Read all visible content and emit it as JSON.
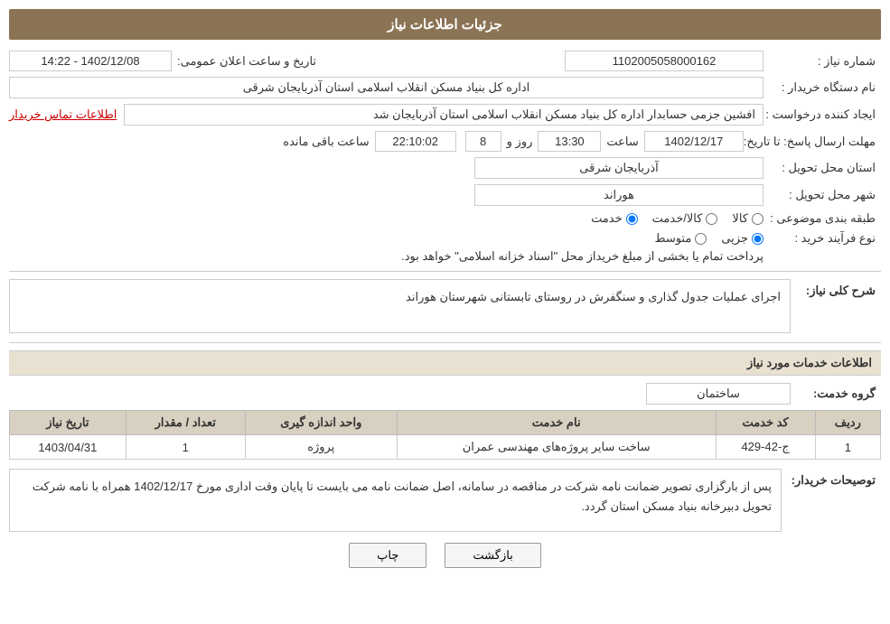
{
  "header": {
    "title": "جزئیات اطلاعات نیاز"
  },
  "fields": {
    "shomara_label": "شماره نیاز :",
    "shomara_value": "1102005058000162",
    "namdastgah_label": "نام دستگاه خریدار :",
    "namdastgah_value": "اداره کل بنیاد مسکن انقلاب اسلامی استان آذربایجان شرقی",
    "ijad_label": "ایجاد کننده درخواست :",
    "ijad_value": "افشین جزمی حسابدار اداره کل بنیاد مسکن انقلاب اسلامی استان آذربایجان شد",
    "ettelaat_tamas": "اطلاعات تماس خریدار",
    "mohlet_label": "مهلت ارسال پاسخ: تا تاریخ:",
    "date_value": "1402/12/17",
    "saaat_label": "ساعت",
    "saaat_value": "13:30",
    "rooz_label": "روز و",
    "rooz_value": "8",
    "baqi_value": "22:10:02",
    "baqi_label": "ساعت باقی مانده",
    "ostan_label": "استان محل تحویل :",
    "ostan_value": "آذربایجان شرقی",
    "shahr_label": "شهر محل تحویل :",
    "shahr_value": "هوراند",
    "tabaqe_label": "طبقه بندی موضوعی :",
    "radio_khidmat": "خدمت",
    "radio_kala_khidmat": "کالا/خدمت",
    "radio_kala": "کالا",
    "noeFarayand_label": "نوع فرآیند خرید :",
    "radio_jozee": "جزیی",
    "radio_motavaset": "متوسط",
    "radio_full_text": "پرداخت تمام یا بخشی از مبلغ خریداز محل \"اسناد خزانه اسلامی\" خواهد بود.",
    "sharh_label": "شرح کلی نیاز:",
    "sharh_value": "اجرای عملیات جدول گذاری و سنگفرش در روستای تابستانی شهرستان هوراند",
    "khidmat_title": "اطلاعات خدمات مورد نیاز",
    "grooh_label": "گروه خدمت:",
    "grooh_value": "ساختمان",
    "table": {
      "headers": [
        "ردیف",
        "کد خدمت",
        "نام خدمت",
        "واحد اندازه گیری",
        "تعداد / مقدار",
        "تاریخ نیاز"
      ],
      "rows": [
        {
          "radif": "1",
          "kod": "ج-42-429",
          "nam": "ساخت سایر پروژه‌های مهندسی عمران",
          "vahed": "پروژه",
          "tedad": "1",
          "tarikh": "1403/04/31"
        }
      ]
    },
    "description_label": "توصیحات خریدار:",
    "description_value": "پس از بارگزاری تصویر ضمانت نامه شرکت در مناقصه در سامانه، اصل ضمانت نامه می بایست تا پایان وقت اداری مورخ 1402/12/17 همراه با نامه شرکت تحویل دبیرخانه بنیاد مسکن استان گردد.",
    "btn_back": "بازگشت",
    "btn_print": "چاپ",
    "tarikho_saat_label": "تاریخ و ساعت اعلان عمومی:",
    "tarikho_saat_value": "1402/12/08 - 14:22"
  }
}
